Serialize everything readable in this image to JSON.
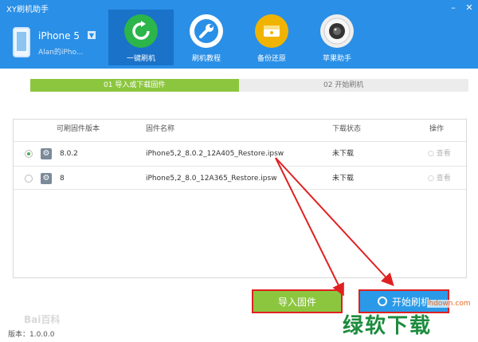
{
  "window": {
    "title": "XY刷机助手"
  },
  "device": {
    "name": "iPhone 5",
    "user": "Alan的iPho..."
  },
  "nav": [
    {
      "label": "一键刷机",
      "icon": "refresh-icon",
      "color": "#2bb54a",
      "active": true
    },
    {
      "label": "刷机教程",
      "icon": "wrench-icon",
      "color": "#2a8fe6"
    },
    {
      "label": "备份还原",
      "icon": "backup-icon",
      "color": "#f0b400"
    },
    {
      "label": "苹果助手",
      "icon": "camera-icon",
      "color": "#333333"
    }
  ],
  "steps": {
    "step1": "01  导入或下载固件",
    "step2": "02  开始刷机"
  },
  "table": {
    "headers": [
      "可刷固件版本",
      "固件名称",
      "下载状态",
      "操作"
    ],
    "rows": [
      {
        "version": "8.0.2",
        "name": "iPhone5,2_8.0.2_12A405_Restore.ipsw",
        "status": "未下载",
        "action": "查看",
        "selected": true
      },
      {
        "version": "8",
        "name": "iPhone5,2_8.0_12A365_Restore.ipsw",
        "status": "未下载",
        "action": "查看",
        "selected": false
      }
    ]
  },
  "buttons": {
    "import": "导入固件",
    "start": "开始刷机"
  },
  "footer": {
    "version": "版本：1.0.0.0"
  },
  "watermarks": {
    "baidu": "Bai百科",
    "site": "lhdown.com",
    "big": "绿软下载"
  },
  "colors": {
    "header": "#2a8fe6",
    "accent_green": "#8cc63f",
    "highlight_red": "#e02020"
  }
}
